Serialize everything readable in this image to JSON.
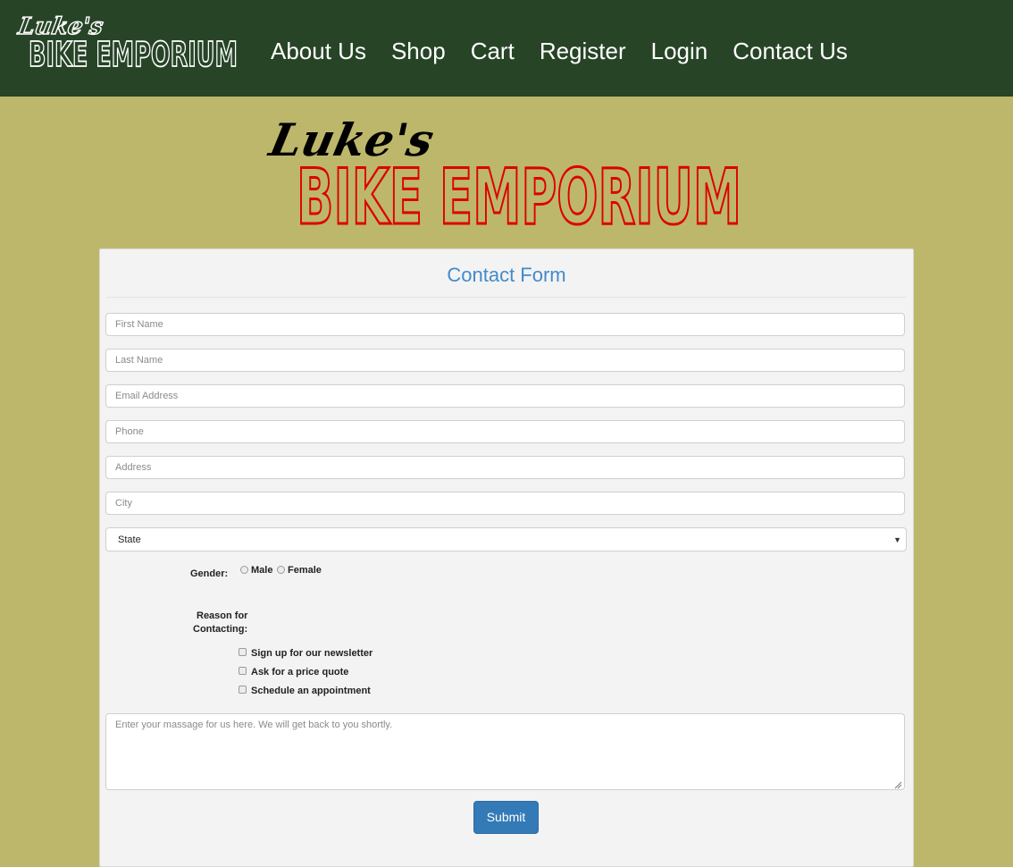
{
  "brand": {
    "script_text": "Luke's",
    "main_text": "BIKE EMPORIUM",
    "nav_logo_color": "#ffffff",
    "banner_color": "#dd0000"
  },
  "nav": {
    "items": [
      {
        "label": "About Us"
      },
      {
        "label": "Shop"
      },
      {
        "label": "Cart"
      },
      {
        "label": "Register"
      },
      {
        "label": "Login"
      },
      {
        "label": "Contact Us"
      }
    ]
  },
  "form": {
    "title": "Contact Form",
    "fields": {
      "first_name": {
        "placeholder": "First Name",
        "value": ""
      },
      "last_name": {
        "placeholder": "Last Name",
        "value": ""
      },
      "email": {
        "placeholder": "Email Address",
        "value": ""
      },
      "phone": {
        "placeholder": "Phone",
        "value": ""
      },
      "address": {
        "placeholder": "Address",
        "value": ""
      },
      "city": {
        "placeholder": "City",
        "value": ""
      }
    },
    "state": {
      "selected": "State"
    },
    "gender": {
      "label": "Gender:",
      "options": [
        {
          "label": "Male",
          "checked": false
        },
        {
          "label": "Female",
          "checked": false
        }
      ]
    },
    "reason": {
      "label_line1": "Reason for",
      "label_line2": "Contacting:",
      "options": [
        {
          "label": "Sign up for our newsletter",
          "checked": false
        },
        {
          "label": "Ask for a price quote",
          "checked": false
        },
        {
          "label": "Schedule an appointment",
          "checked": false
        }
      ]
    },
    "message": {
      "placeholder": "Enter your massage for us here. We will get back to you shortly.",
      "value": ""
    },
    "submit_label": "Submit"
  },
  "colors": {
    "page_background": "#bdb76b",
    "navbar": "#274427",
    "title_accent": "#428bca",
    "submit_button": "#337ab7"
  }
}
